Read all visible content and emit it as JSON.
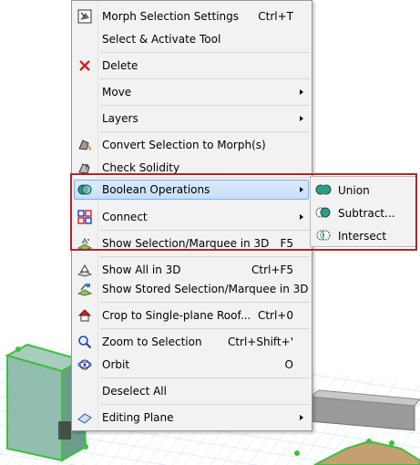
{
  "menu": {
    "items": [
      {
        "label": "Morph Selection Settings",
        "shortcut": "Ctrl+T",
        "icon": "morph-settings-icon"
      },
      {
        "label": "Select & Activate Tool",
        "shortcut": "",
        "icon": ""
      },
      {
        "label": "Delete",
        "shortcut": "",
        "icon": "delete-x-icon"
      },
      {
        "label": "Move",
        "shortcut": "",
        "icon": "",
        "submenu": true
      },
      {
        "label": "Layers",
        "shortcut": "",
        "icon": "",
        "submenu": true
      },
      {
        "label": "Convert Selection to Morph(s)",
        "shortcut": "",
        "icon": "convert-morph-icon"
      },
      {
        "label": "Check Solidity",
        "shortcut": "",
        "icon": "check-solidity-icon"
      },
      {
        "label": "Boolean Operations",
        "shortcut": "",
        "icon": "boolean-operations-icon",
        "submenu": true,
        "highlighted": true
      },
      {
        "label": "Connect",
        "shortcut": "",
        "icon": "connect-icon",
        "submenu": true
      },
      {
        "label": "Show Selection/Marquee in 3D",
        "shortcut": "F5",
        "icon": "show-selection-3d-icon"
      },
      {
        "label": "Show All in 3D",
        "shortcut": "Ctrl+F5",
        "icon": "show-all-3d-icon"
      },
      {
        "label": "Show Stored Selection/Marquee in 3D",
        "shortcut": "",
        "icon": "show-stored-selection-icon"
      },
      {
        "label": "Crop to Single-plane Roof...",
        "shortcut": "Ctrl+0",
        "icon": "crop-roof-icon"
      },
      {
        "label": "Zoom to Selection",
        "shortcut": "Ctrl+Shift+'",
        "icon": "zoom-selection-icon"
      },
      {
        "label": "Orbit",
        "shortcut": "O",
        "icon": "orbit-icon"
      },
      {
        "label": "Deselect All",
        "shortcut": "",
        "icon": ""
      },
      {
        "label": "Editing Plane",
        "shortcut": "",
        "icon": "editing-plane-icon",
        "submenu": true
      }
    ]
  },
  "submenu": {
    "items": [
      {
        "label": "Union",
        "icon": "union-icon"
      },
      {
        "label": "Subtract...",
        "icon": "subtract-icon"
      },
      {
        "label": "Intersect",
        "icon": "intersect-icon"
      }
    ]
  },
  "colors": {
    "menu_bg": "#f2f2f2",
    "highlight_bg": "#c6dff7",
    "highlight_border": "#84aee0",
    "callout_frame": "#b3262c",
    "selection_green": "#3fbf3f"
  }
}
